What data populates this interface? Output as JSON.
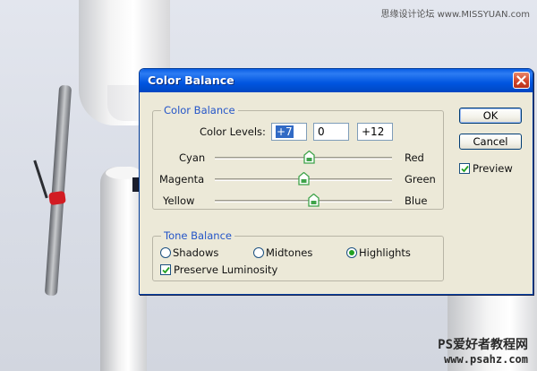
{
  "watermark": {
    "top": "思缘设计论坛 www.MISSYUAN.com",
    "bottom_line1": "PS爱好者教程网",
    "bottom_line2": "www.psahz.com"
  },
  "dialog": {
    "title": "Color Balance",
    "color_balance": {
      "group_label": "Color Balance",
      "levels_label": "Color Levels:",
      "levels": [
        "+7",
        "0",
        "+12"
      ],
      "sliders": [
        {
          "left": "Cyan",
          "right": "Red",
          "value": 7
        },
        {
          "left": "Magenta",
          "right": "Green",
          "value": 0
        },
        {
          "left": "Yellow",
          "right": "Blue",
          "value": 12
        }
      ],
      "slider_range": [
        -100,
        100
      ]
    },
    "tone_balance": {
      "group_label": "Tone Balance",
      "options": [
        "Shadows",
        "Midtones",
        "Highlights"
      ],
      "selected": "Highlights",
      "preserve_luminosity_label": "Preserve Luminosity",
      "preserve_luminosity": true
    },
    "buttons": {
      "ok": "OK",
      "cancel": "Cancel"
    },
    "preview_label": "Preview",
    "preview": true
  },
  "colors": {
    "titlebar": "#0055e0",
    "group_label": "#2455c8",
    "handle": "#3fa34a",
    "radio_dot": "#21a121"
  },
  "icons": [
    "close-icon",
    "slider-handle-icon",
    "checkmark-icon"
  ]
}
